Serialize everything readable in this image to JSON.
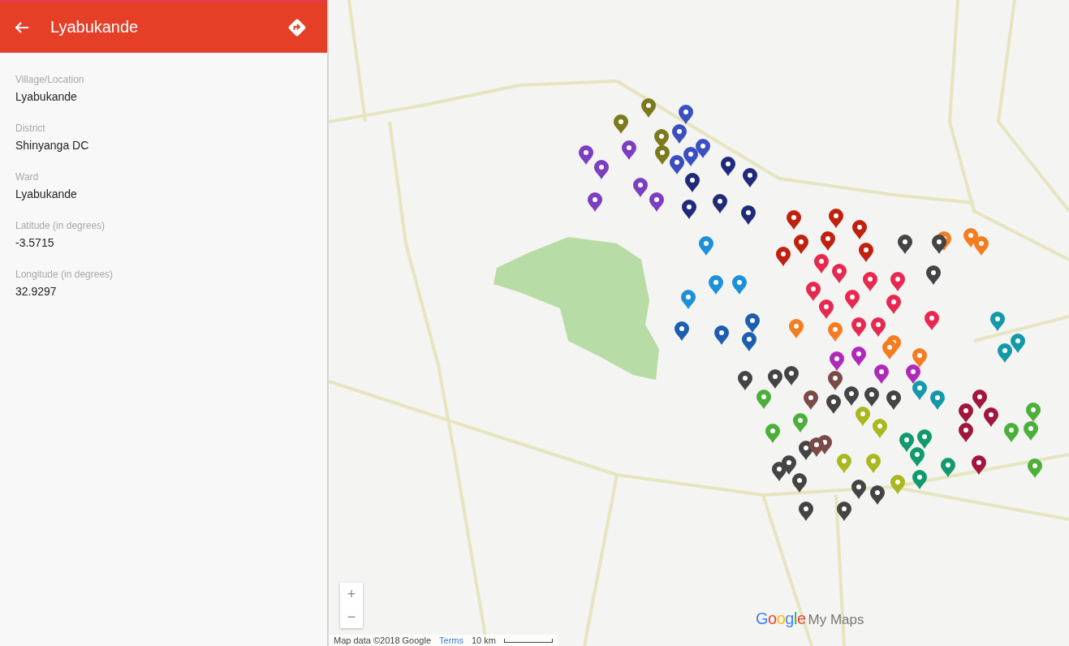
{
  "header": {
    "title": "Lyabukande"
  },
  "fields": [
    {
      "label": "Village/Location",
      "value": "Lyabukande"
    },
    {
      "label": "District",
      "value": "Shinyanga DC"
    },
    {
      "label": "Ward",
      "value": "Lyabukande"
    },
    {
      "label": "Latitude (in degrees)",
      "value": "-3.5715"
    },
    {
      "label": "Longitude (in degrees)",
      "value": "32.9297"
    }
  ],
  "zoom_controls": [
    "+",
    "−"
  ],
  "logo": {
    "brand": "Google",
    "product": "My Maps"
  },
  "attribution": {
    "map_data": "Map data ©2018 Google",
    "terms": "Terms",
    "scale": "10 km"
  }
}
